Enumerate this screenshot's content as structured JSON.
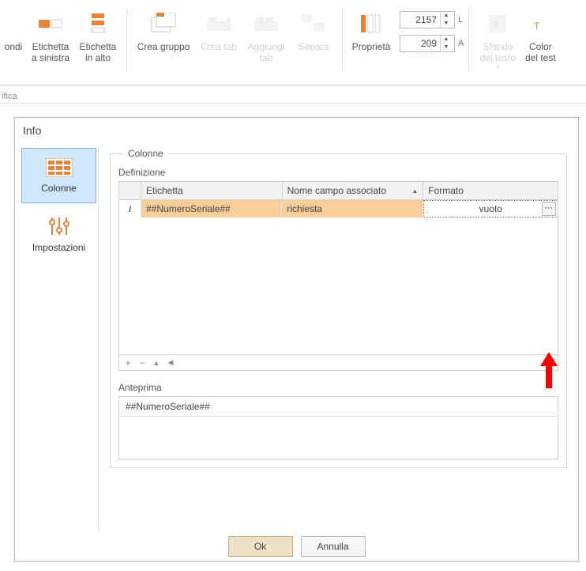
{
  "ribbon": {
    "truncated_btn": "ondi",
    "label_left": "Etichetta\na sinistra",
    "label_top": "Etichetta\nin alto",
    "create_group": "Crea gruppo",
    "create_tab": "Crea tab",
    "add_tab": "Aggiungi\ntab",
    "separate": "Separa",
    "properties": "Proprietà",
    "spin_l_value": "2157",
    "spin_l_unit": "L",
    "spin_a_value": "209",
    "spin_a_unit": "A",
    "text_bg": "Sfondo\ndel testo",
    "text_color": "Color\ndel test",
    "group_caption_edit": "ifica"
  },
  "dialog": {
    "title": "Info",
    "tabs": {
      "columns": "Colonne",
      "settings": "Impostazioni"
    },
    "fs_columns": "Colonne",
    "definition": "Definizione",
    "preview": "Anteprima",
    "headers": {
      "label": "Etichetta",
      "field": "Nome campo associato",
      "format": "Formato"
    },
    "rows": [
      {
        "marker": "I",
        "label": "##NumeroSeriale##",
        "field": "richiesta",
        "format": "vuoto"
      }
    ],
    "preview_value": "##NumeroSeriale##",
    "ok": "Ok",
    "cancel": "Annulla"
  }
}
